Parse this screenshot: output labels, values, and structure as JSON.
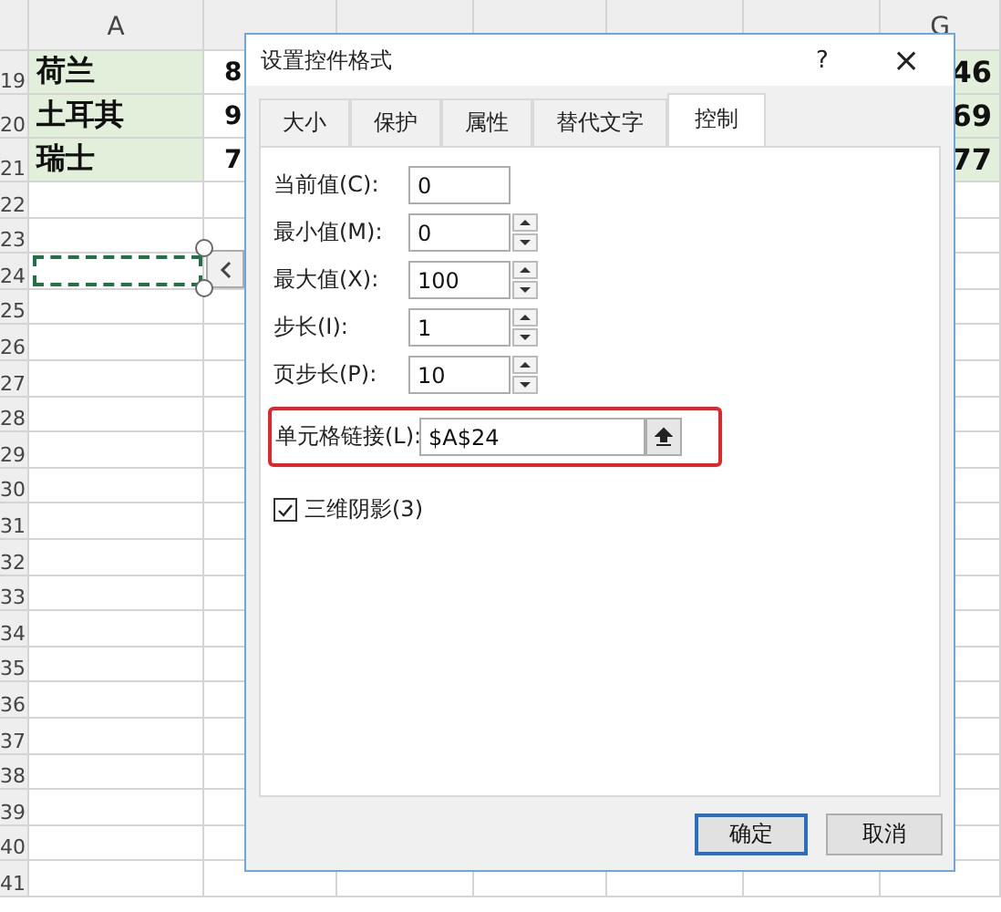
{
  "sheet": {
    "column_headers": [
      "A",
      "G"
    ],
    "rows": [
      {
        "number": "19",
        "cells": [
          "荷兰",
          "8",
          "46"
        ],
        "selected": false
      },
      {
        "number": "20",
        "cells": [
          "土耳其",
          "9",
          "69"
        ],
        "selected": false
      },
      {
        "number": "21",
        "cells": [
          "瑞士",
          "7",
          "77"
        ],
        "selected": false
      },
      {
        "number": "22",
        "selected": false
      },
      {
        "number": "23",
        "selected": false
      },
      {
        "number": "24",
        "selected": true
      },
      {
        "number": "25",
        "selected": false
      },
      {
        "number": "26",
        "selected": false
      },
      {
        "number": "27",
        "selected": false
      },
      {
        "number": "28",
        "selected": false
      },
      {
        "number": "29",
        "selected": false
      },
      {
        "number": "30",
        "selected": false
      },
      {
        "number": "31",
        "selected": false
      },
      {
        "number": "32",
        "selected": false
      },
      {
        "number": "33",
        "selected": false
      },
      {
        "number": "34",
        "selected": false
      },
      {
        "number": "35",
        "selected": false
      },
      {
        "number": "36",
        "selected": false
      },
      {
        "number": "37",
        "selected": false
      },
      {
        "number": "38",
        "selected": false
      },
      {
        "number": "39",
        "selected": false
      },
      {
        "number": "40",
        "selected": false
      },
      {
        "number": "41",
        "selected": false
      }
    ]
  },
  "dialog": {
    "title": "设置控件格式",
    "help": "?",
    "close": "×",
    "tabs": [
      {
        "label": "大小",
        "selected": false
      },
      {
        "label": "保护",
        "selected": false
      },
      {
        "label": "属性",
        "selected": false
      },
      {
        "label": "替代文字",
        "selected": false
      },
      {
        "label": "控制",
        "selected": true
      }
    ],
    "fields": [
      {
        "label": "当前值(C):",
        "value": "0",
        "kind": "plain"
      },
      {
        "label": "最小值(M):",
        "value": "0",
        "kind": "spin"
      },
      {
        "label": "最大值(X):",
        "value": "100",
        "kind": "spin"
      },
      {
        "label": "步长(I):",
        "value": "1",
        "kind": "spin"
      },
      {
        "label": "页步长(P):",
        "value": "10",
        "kind": "spin"
      }
    ],
    "cell_link": {
      "label": "单元格链接(L):",
      "value": "$A$24"
    },
    "checkbox": {
      "label": "三维阴影(3)",
      "checked": true
    },
    "buttons": [
      {
        "label": "确定",
        "default": true
      },
      {
        "label": "取消",
        "default": false
      }
    ]
  }
}
